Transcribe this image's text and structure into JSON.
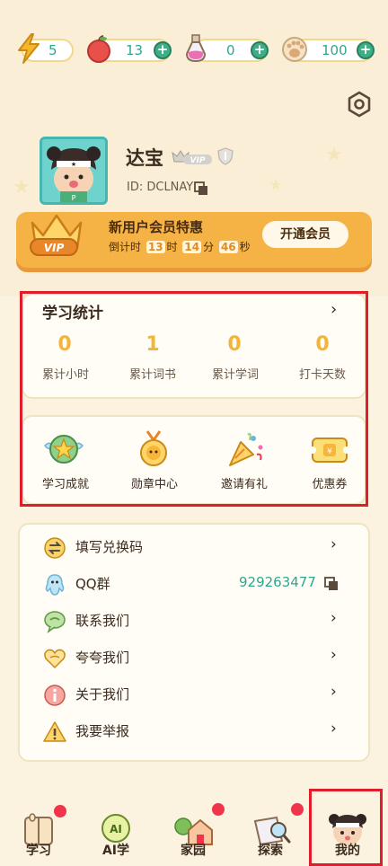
{
  "resources": {
    "energy": "5",
    "apple": "13",
    "potion": "0",
    "paw": "100"
  },
  "profile": {
    "name": "达宝",
    "id_text": "ID: DCLNAY",
    "vip_badge": "VIP"
  },
  "vip_banner": {
    "crown_text": "VIP",
    "title": "新用户会员特惠",
    "countdown_prefix": "倒计时",
    "hours": "13",
    "hours_unit": "时",
    "minutes": "14",
    "minutes_unit": "分",
    "seconds": "46",
    "seconds_unit": "秒",
    "button": "开通会员"
  },
  "study_stats": {
    "title": "学习统计",
    "items": [
      {
        "value": "0",
        "label": "累计小时"
      },
      {
        "value": "1",
        "label": "累计词书"
      },
      {
        "value": "0",
        "label": "累计学词"
      },
      {
        "value": "0",
        "label": "打卡天数"
      }
    ]
  },
  "entries": [
    {
      "label": "学习成就",
      "icon": "star-wings-icon"
    },
    {
      "label": "勋章中心",
      "icon": "medal-icon"
    },
    {
      "label": "邀请有礼",
      "icon": "party-popper-icon"
    },
    {
      "label": "优惠券",
      "icon": "coupon-icon"
    }
  ],
  "list": [
    {
      "label": "填写兑换码",
      "icon": "exchange-icon"
    },
    {
      "label": "QQ群",
      "icon": "qq-icon",
      "value": "929263477"
    },
    {
      "label": "联系我们",
      "icon": "chat-icon"
    },
    {
      "label": "夸夸我们",
      "icon": "heart-icon"
    },
    {
      "label": "关于我们",
      "icon": "info-icon"
    },
    {
      "label": "我要举报",
      "icon": "warning-icon"
    }
  ],
  "nav": [
    {
      "label": "学习",
      "icon": "book-icon",
      "badge": true
    },
    {
      "label": "AI学",
      "icon": "ai-icon",
      "badge": false
    },
    {
      "label": "家园",
      "icon": "home-icon",
      "badge": true
    },
    {
      "label": "探索",
      "icon": "explore-icon",
      "badge": true
    },
    {
      "label": "我的",
      "icon": "profile-avatar-icon",
      "badge": false
    }
  ],
  "colors": {
    "background": "#fbf3df",
    "accent_orange": "#f6b345",
    "teal": "#2fa68f",
    "highlight_red": "#e11d2b",
    "badge_red": "#f0344b"
  }
}
